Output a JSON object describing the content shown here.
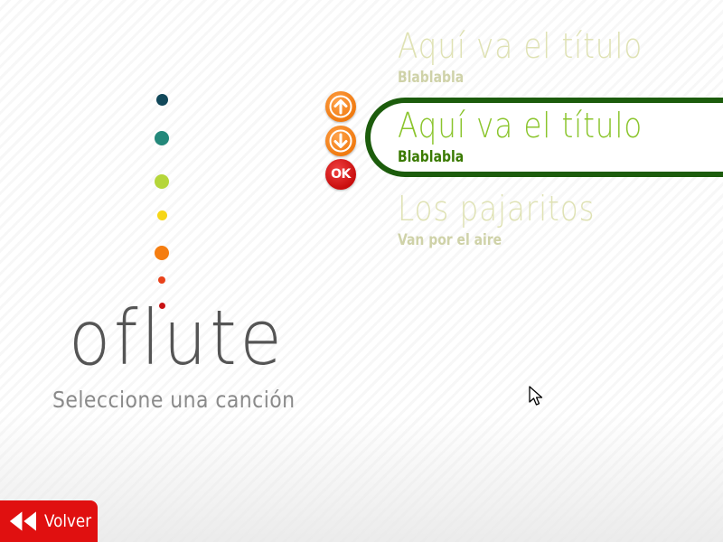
{
  "app": {
    "logo": "oflute",
    "subtitle": "Seleccione una canción"
  },
  "colors": {
    "dots": [
      "#11485a",
      "#23887a",
      "#b5d63a",
      "#f6d617",
      "#f57d10",
      "#e9421a",
      "#c81214"
    ],
    "accent_orange": "#f07a10",
    "accent_red": "#e01010",
    "selector_border": "#1c5c0c",
    "active_title": "#8bc52d",
    "active_artist": "#3a7a00"
  },
  "controls": {
    "up_icon": "arrow-up-icon",
    "down_icon": "arrow-down-icon",
    "ok_label": "OK"
  },
  "songs": [
    {
      "title": "Aquí va el título",
      "artist": "Blablabla"
    },
    {
      "title": "Aquí va el título",
      "artist": "Blablabla"
    },
    {
      "title": "Los pajaritos",
      "artist": "Van por el aire"
    }
  ],
  "selected_index": 1,
  "footer": {
    "back_label": "Volver",
    "back_icon": "rewind-icon"
  }
}
